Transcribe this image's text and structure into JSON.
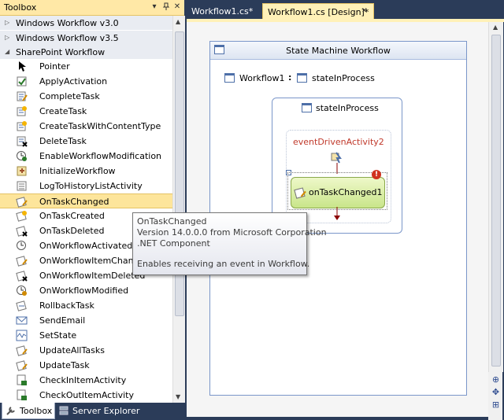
{
  "toolbox": {
    "title": "Toolbox",
    "pin_glyph": "📌",
    "groups": [
      {
        "label": "Windows Workflow v3.0",
        "expanded": false
      },
      {
        "label": "Windows Workflow v3.5",
        "expanded": false
      },
      {
        "label": "SharePoint Workflow",
        "expanded": true
      }
    ],
    "items": [
      {
        "label": "Pointer",
        "icon": "pointer-icon"
      },
      {
        "label": "ApplyActivation",
        "icon": "apply-activation-icon"
      },
      {
        "label": "CompleteTask",
        "icon": "complete-task-icon"
      },
      {
        "label": "CreateTask",
        "icon": "create-task-icon"
      },
      {
        "label": "CreateTaskWithContentType",
        "icon": "create-task-content-type-icon"
      },
      {
        "label": "DeleteTask",
        "icon": "delete-task-icon"
      },
      {
        "label": "EnableWorkflowModification",
        "icon": "enable-workflow-modification-icon"
      },
      {
        "label": "InitializeWorkflow",
        "icon": "initialize-workflow-icon"
      },
      {
        "label": "LogToHistoryListActivity",
        "icon": "log-history-icon"
      },
      {
        "label": "OnTaskChanged",
        "icon": "on-task-changed-icon",
        "selected": true
      },
      {
        "label": "OnTaskCreated",
        "icon": "on-task-created-icon"
      },
      {
        "label": "OnTaskDeleted",
        "icon": "on-task-deleted-icon"
      },
      {
        "label": "OnWorkflowActivated",
        "icon": "on-workflow-activated-icon"
      },
      {
        "label": "OnWorkflowItemChange",
        "icon": "on-workflow-item-changed-icon"
      },
      {
        "label": "OnWorkflowItemDeleted",
        "icon": "on-workflow-item-deleted-icon"
      },
      {
        "label": "OnWorkflowModified",
        "icon": "on-workflow-modified-icon"
      },
      {
        "label": "RollbackTask",
        "icon": "rollback-task-icon"
      },
      {
        "label": "SendEmail",
        "icon": "send-email-icon"
      },
      {
        "label": "SetState",
        "icon": "set-state-icon"
      },
      {
        "label": "UpdateAllTasks",
        "icon": "update-all-tasks-icon"
      },
      {
        "label": "UpdateTask",
        "icon": "update-task-icon"
      },
      {
        "label": "CheckInItemActivity",
        "icon": "check-in-item-icon"
      },
      {
        "label": "CheckOutItemActivity",
        "icon": "check-out-item-icon"
      }
    ],
    "bottom_tabs": [
      {
        "label": "Toolbox",
        "active": true
      },
      {
        "label": "Server Explorer",
        "active": false
      }
    ]
  },
  "document_tabs": [
    {
      "label": "Workflow1.cs*",
      "active": false
    },
    {
      "label": "Workflow1.cs [Design]*",
      "active": true
    }
  ],
  "designer": {
    "workflow_title": "State Machine Workflow",
    "workflow_name": "Workflow1",
    "separator": ":",
    "current_state": "stateInProcess",
    "state_title": "stateInProcess",
    "event_driven": "eventDrivenActivity2",
    "activity": "onTaskChanged1",
    "error_glyph": "!"
  },
  "tooltip": {
    "title": "OnTaskChanged",
    "version": "Version 14.0.0.0 from Microsoft Corporation",
    "component": ".NET Component",
    "description": "Enables receiving an event in Workflow."
  },
  "colors": {
    "chrome": "#2b3c59",
    "tab_active": "#fff1b8",
    "selected_item": "#fde59b",
    "activity_fill": "#c9e58a",
    "event_label": "#c0392b",
    "arrow": "#8b0000"
  }
}
